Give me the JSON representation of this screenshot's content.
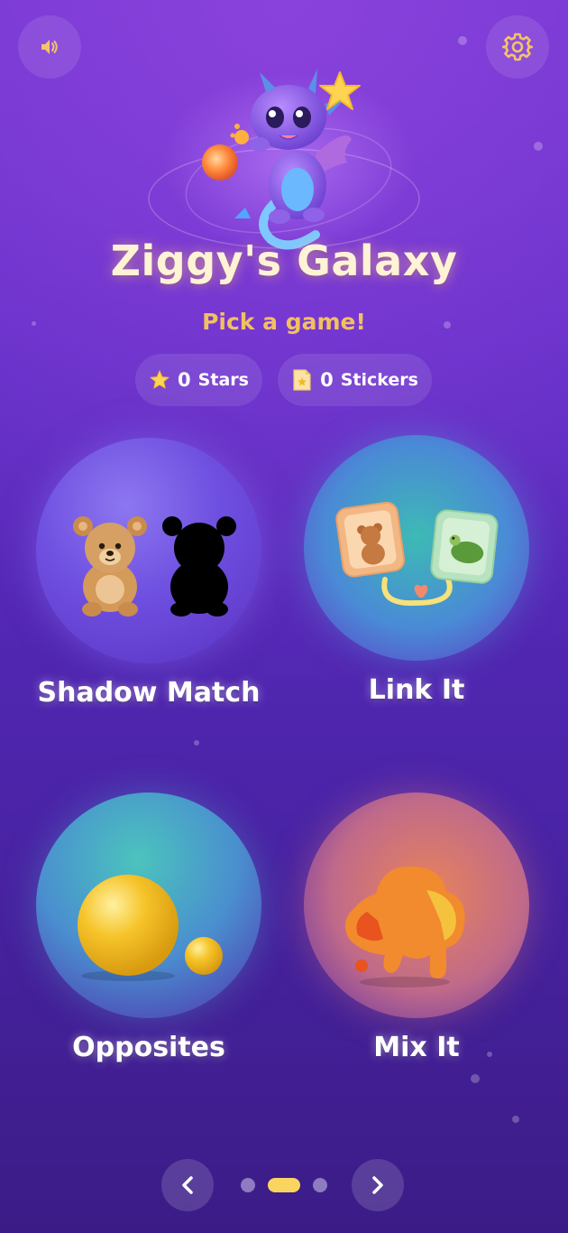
{
  "header": {
    "sound_icon": "speaker-icon",
    "settings_icon": "gear-icon"
  },
  "hero": {
    "title": "Ziggy's Galaxy",
    "subtitle": "Pick a game!"
  },
  "stats": {
    "stars_count": "0",
    "stars_label": "Stars",
    "stickers_count": "0",
    "stickers_label": "Stickers"
  },
  "games": [
    {
      "label": "Shadow Match",
      "icon": "teddy-bear-and-shadow-icon"
    },
    {
      "label": "Link It",
      "icon": "linked-cards-icon"
    },
    {
      "label": "Opposites",
      "icon": "big-and-small-balls-icon"
    },
    {
      "label": "Mix It",
      "icon": "paint-splash-icon"
    }
  ],
  "pager": {
    "prev_icon": "chevron-left-icon",
    "next_icon": "chevron-right-icon",
    "pages": 3,
    "current_page": 2
  },
  "colors": {
    "background_top": "#8a42dc",
    "background_bottom": "#3b1c86",
    "title": "#fff3d6",
    "subtitle": "#f2c060",
    "active_dot": "#f9d55f",
    "inactive_dot": "#8e7bc2"
  }
}
